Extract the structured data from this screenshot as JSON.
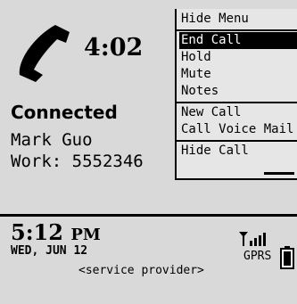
{
  "call": {
    "timer": "4:02",
    "status": "Connected",
    "contact_name": "Mark Guo",
    "contact_number": "Work: 5552346"
  },
  "menu": {
    "header": "Hide Menu",
    "items": [
      {
        "label": "End Call",
        "selected": true
      },
      {
        "label": "Hold"
      },
      {
        "label": "Mute"
      },
      {
        "label": "Notes"
      },
      {
        "label": "New Call"
      },
      {
        "label": "Call Voice Mail"
      },
      {
        "label": "Hide Call"
      }
    ]
  },
  "status_bar": {
    "time": "5:12",
    "ampm": "PM",
    "date": "WED, JUN 12",
    "provider": "<service provider>",
    "network": "GPRS",
    "signal_icon": "signal-bars-icon",
    "battery_icon": "battery-icon"
  },
  "colors": {
    "background": "#d9d9d9",
    "menu_background": "#e6e6e6",
    "selection": "#000000"
  }
}
